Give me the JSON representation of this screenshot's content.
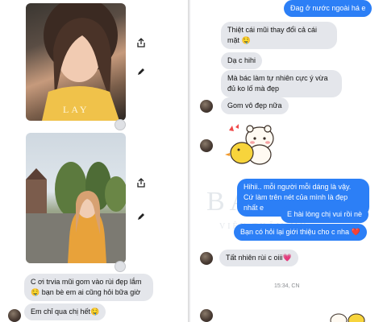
{
  "left_panel": {
    "messages": [
      {
        "lines": [
          "C ơi trvia mũi gom vào rùi đẹp lắm",
          "🤤 bạn bè em ai cũng hỏi bữa giờ"
        ]
      },
      {
        "lines": [
          "Em chỉ qua chị hết🤤"
        ]
      }
    ]
  },
  "right_panel": {
    "messages_top": [
      {
        "text": "Đag ở nước ngoài há e",
        "side": "out"
      },
      {
        "text": "Thiệt cái mũi thay đổi cả cái mặt 🤤",
        "side": "in"
      },
      {
        "text": "Dạ c hihi",
        "side": "in"
      },
      {
        "text": "Mà bác làm tự nhiên cực ý vừa đủ ko lố mà đẹp",
        "side": "in"
      },
      {
        "text": "Gom vô đẹp nữa",
        "side": "in"
      }
    ],
    "messages_bottom": [
      {
        "text": "Hihii.. mỗi người mỗi dáng là vậy. Cứ làm trên nét của mình là đẹp nhất e",
        "side": "out"
      },
      {
        "text": "E hài lòng chị vui rồi nè",
        "side": "out"
      },
      {
        "text": "Bạn có hỏi lại giới thiệu cho c nha ❤️",
        "side": "out"
      },
      {
        "text": "Tất nhiên rùi c oiii💗",
        "side": "in"
      }
    ],
    "timestamp": "15:34, CN"
  },
  "watermark": {
    "line1": "BATIN",
    "line2": "VIỆN THẨM MỸ"
  },
  "colors": {
    "accent": "#2c7ff6",
    "incoming": "#e4e6eb",
    "background": "#ffffff"
  },
  "icons": [
    "share-icon",
    "edit-icon",
    "seen-indicator-icon",
    "sticker-bear-duck"
  ]
}
